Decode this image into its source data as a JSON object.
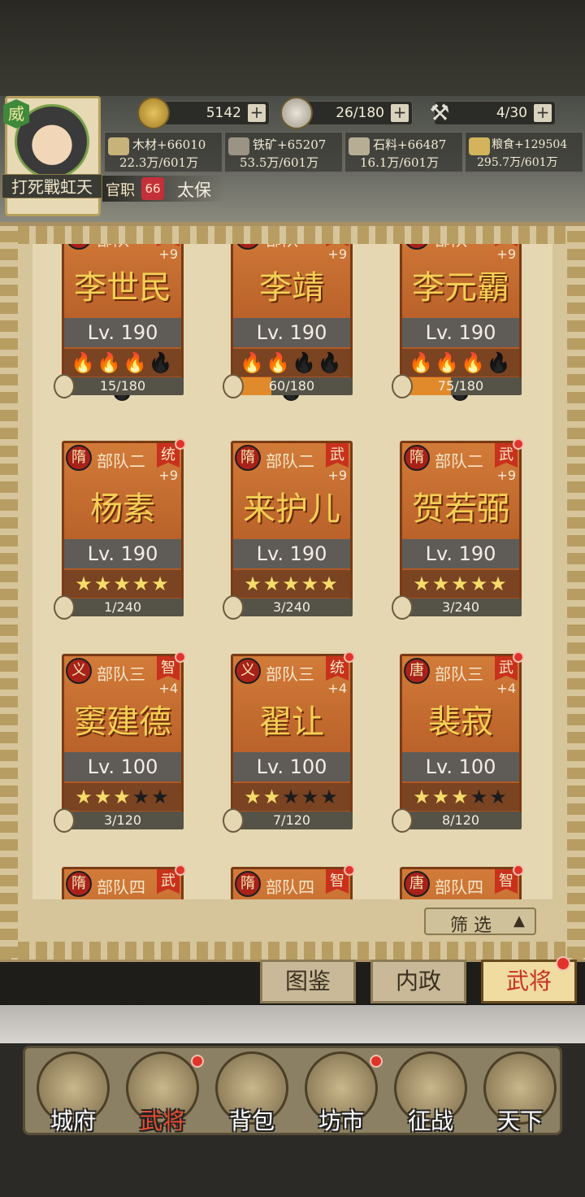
{
  "player": {
    "badge": "威",
    "name": "打死戰虹天",
    "rank_label": "官职",
    "rank_level": "66",
    "rank_title": "太保"
  },
  "resources": [
    {
      "icon": "gold-ingot-icon",
      "value": "5142"
    },
    {
      "icon": "silver-coin-icon",
      "value": "26/180"
    },
    {
      "icon": "axe-icon",
      "value": "4/30"
    }
  ],
  "materials": [
    {
      "icon": "wood-icon",
      "name": "木材",
      "rate": "+66010",
      "stock": "22.3万/601万"
    },
    {
      "icon": "iron-ore-icon",
      "name": "铁矿",
      "rate": "+65207",
      "stock": "53.5万/601万"
    },
    {
      "icon": "stone-icon",
      "name": "石料",
      "rate": "+66487",
      "stock": "16.1万/601万"
    },
    {
      "icon": "grain-icon",
      "name": "粮食",
      "rate": "+129504",
      "stock": "295.7万/601万"
    }
  ],
  "generals": [
    {
      "dynasty": "唐",
      "unit": "部队",
      "tag": "统",
      "plus": "+9",
      "name": "李世民",
      "level": "Lv. 190",
      "rating": "flames",
      "filled": 3,
      "total": 5,
      "shards": "15/180",
      "progress": 0.083,
      "dot": false
    },
    {
      "dynasty": "唐",
      "unit": "部队",
      "tag": "武",
      "plus": "+9",
      "name": "李靖",
      "level": "Lv. 190",
      "rating": "flames",
      "filled": 2,
      "total": 5,
      "shards": "60/180",
      "progress": 0.333,
      "dot": false
    },
    {
      "dynasty": "唐",
      "unit": "部队",
      "tag": "武",
      "plus": "+9",
      "name": "李元霸",
      "level": "Lv. 190",
      "rating": "flames",
      "filled": 3,
      "total": 5,
      "shards": "75/180",
      "progress": 0.417,
      "dot": false
    },
    {
      "dynasty": "隋",
      "unit": "部队二",
      "tag": "统",
      "plus": "+9",
      "name": "杨素",
      "level": "Lv. 190",
      "rating": "stars",
      "filled": 5,
      "total": 5,
      "shards": "1/240",
      "progress": 0.004,
      "dot": true
    },
    {
      "dynasty": "隋",
      "unit": "部队二",
      "tag": "武",
      "plus": "+9",
      "name": "来护儿",
      "level": "Lv. 190",
      "rating": "stars",
      "filled": 5,
      "total": 5,
      "shards": "3/240",
      "progress": 0.0125,
      "dot": false
    },
    {
      "dynasty": "隋",
      "unit": "部队二",
      "tag": "武",
      "plus": "+9",
      "name": "贺若弼",
      "level": "Lv. 190",
      "rating": "stars",
      "filled": 5,
      "total": 5,
      "shards": "3/240",
      "progress": 0.0125,
      "dot": true
    },
    {
      "dynasty": "义",
      "unit": "部队三",
      "tag": "智",
      "plus": "+4",
      "name": "窦建德",
      "level": "Lv. 100",
      "rating": "stars",
      "filled": 3,
      "total": 5,
      "shards": "3/120",
      "progress": 0.025,
      "dot": true
    },
    {
      "dynasty": "义",
      "unit": "部队三",
      "tag": "统",
      "plus": "+4",
      "name": "翟让",
      "level": "Lv. 100",
      "rating": "stars",
      "filled": 2,
      "total": 5,
      "shards": "7/120",
      "progress": 0.058,
      "dot": true
    },
    {
      "dynasty": "唐",
      "unit": "部队三",
      "tag": "武",
      "plus": "+4",
      "name": "裴寂",
      "level": "Lv. 100",
      "rating": "stars",
      "filled": 3,
      "total": 5,
      "shards": "8/120",
      "progress": 0.067,
      "dot": true
    },
    {
      "dynasty": "隋",
      "unit": "部队四",
      "tag": "武",
      "plus": "",
      "name": "",
      "level": "",
      "rating": "stars",
      "filled": 0,
      "total": 0,
      "shards": "",
      "progress": 0,
      "dot": true
    },
    {
      "dynasty": "隋",
      "unit": "部队四",
      "tag": "智",
      "plus": "",
      "name": "",
      "level": "",
      "rating": "stars",
      "filled": 0,
      "total": 0,
      "shards": "",
      "progress": 0,
      "dot": true
    },
    {
      "dynasty": "唐",
      "unit": "部队四",
      "tag": "智",
      "plus": "",
      "name": "",
      "level": "",
      "rating": "stars",
      "filled": 0,
      "total": 0,
      "shards": "",
      "progress": 0,
      "dot": true
    }
  ],
  "filter": {
    "label": "筛 选",
    "arrow": "▲"
  },
  "subtabs": [
    {
      "label": "图鉴",
      "active": false
    },
    {
      "label": "内政",
      "active": false
    },
    {
      "label": "武将",
      "active": true
    }
  ],
  "nav": [
    {
      "icon": "city-hall-icon",
      "label": "城府",
      "active": false,
      "dot": false
    },
    {
      "icon": "general-icon",
      "label": "武将",
      "active": true,
      "dot": true
    },
    {
      "icon": "bag-icon",
      "label": "背包",
      "active": false,
      "dot": false
    },
    {
      "icon": "market-cart-icon",
      "label": "坊市",
      "active": false,
      "dot": true
    },
    {
      "icon": "horn-icon",
      "label": "征战",
      "active": false,
      "dot": false
    },
    {
      "icon": "throne-icon",
      "label": "天下",
      "active": false,
      "dot": false
    }
  ],
  "colors": {
    "card": "#c96a2d",
    "flame_on": "#f28a1a",
    "flame_off": "#1c1c1c",
    "star_on": "#f5dc6a",
    "star_off": "#1c1c1c",
    "active_tab": "#c7311f"
  }
}
